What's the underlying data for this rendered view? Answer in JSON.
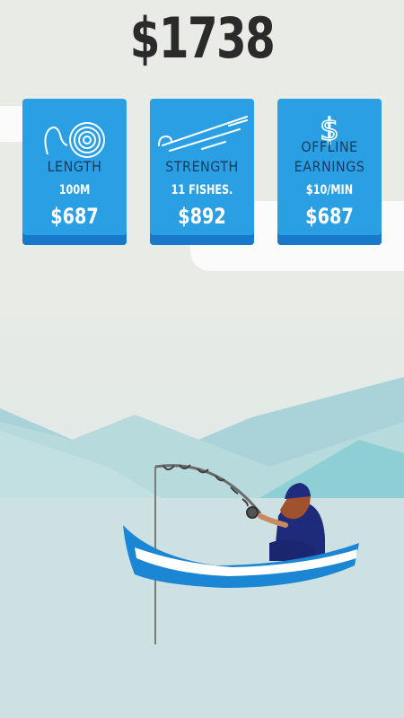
{
  "balance": "$1738",
  "upgrades": [
    {
      "title": "LENGTH",
      "subtitle": "100M",
      "price": "$687",
      "icon": "rope-coil-icon"
    },
    {
      "title": "STRENGTH",
      "subtitle": "11 FISHES.",
      "price": "$892",
      "icon": "hook-line-icon"
    },
    {
      "title": "OFFLINE EARNINGS",
      "title_lines": [
        "OFFLINE",
        "EARNINGS"
      ],
      "subtitle": "$10/MIN",
      "price": "$687",
      "icon": "dollar-icon"
    }
  ],
  "colors": {
    "card": "#2a9fe3",
    "card_shadow": "#1878c9",
    "card_title": "#163d5e",
    "balance_text": "#2b2b2b",
    "water": "#cde0e2",
    "boat": "#1a86d4"
  }
}
